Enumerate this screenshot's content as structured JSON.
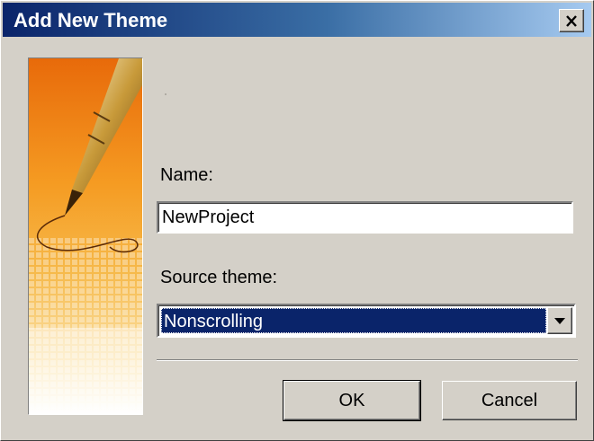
{
  "window": {
    "title": "Add New Theme",
    "close_glyph": "✕"
  },
  "form": {
    "name_label": "Name:",
    "name_value": "NewProject",
    "source_label": "Source theme:",
    "source_value": "Nonscrolling"
  },
  "buttons": {
    "ok_label": "OK",
    "cancel_label": "Cancel"
  },
  "icons": {
    "close": "close-icon",
    "dropdown": "chevron-down-icon",
    "art": "fountain-pen-illustration"
  },
  "colors": {
    "dialog_bg": "#d4d0c8",
    "title_start": "#0a246a",
    "title_end": "#a6caf0",
    "selection": "#0a246a",
    "art_orange": "#f08a1a"
  }
}
